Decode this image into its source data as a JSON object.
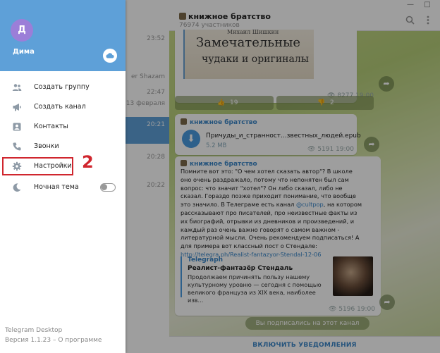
{
  "window": {
    "controls": [
      "—",
      "□"
    ]
  },
  "chatlist": {
    "rows": [
      {
        "time": "23:52",
        "snippet": "",
        "active": false
      },
      {
        "time": "",
        "snippet": "er Shazam",
        "active": false
      },
      {
        "time": "22:47",
        "snippet": "13 февраля",
        "active": false
      },
      {
        "time": "20:21",
        "snippet": "",
        "active": true
      },
      {
        "time": "20:28",
        "snippet": "",
        "active": false
      },
      {
        "time": "20:22",
        "snippet": "",
        "active": false
      }
    ]
  },
  "chat": {
    "title": "книжное братство",
    "subtitle": "76974 участников",
    "book_top_text": "Михаил Шишкин",
    "book_line1": "Замечательные",
    "book_line2": "чудаки и оригиналы",
    "msg1_meta": "8277  19:00",
    "reaction_like_count": "19",
    "reaction_dislike_count": "2",
    "file_source": "книжное братство",
    "file_name": "Причуды_и_странност...звестных_людей.epub",
    "file_size": "5.2 MB",
    "file_meta": "5191  19:00",
    "text_source": "книжное братство",
    "text_body_1": "Помните вот это: \"О чем хотел сказать автор\"? В школе оно очень раздражало, потому что непонятен был сам вопрос: что значит \"хотел\"? Он либо сказал, либо не сказал. Гораздо позже приходит понимание, что вообще это значило. В Телеграме есть канал ",
    "text_link_1": "@cultpop",
    "text_body_2": ", на котором рассказывают про писателей, про неизвестные факты из их биографий, отрывки из дневников и произведений, и каждый раз очень важно говорят о самом важном - литературной мысли. Очень рекомендуем подписаться! А для примера вот классный пост о Стендале:",
    "text_link_2": "http://telegra.ph/Realist-fantazyor-Stendal-12-06",
    "preview_site": "Telegraph",
    "preview_title": "Реалист-фантазёр Стендаль",
    "preview_desc": "Продолжаем причинять пользу нашему культурному уровню — сегодня с помощью великого француза из XIX века, наиболее изв...",
    "text_meta": "5196  19:00",
    "subscribed_text": "Вы подписались на этот канал",
    "notify_label": "ВКЛЮЧИТЬ УВЕДОМЛЕНИЯ"
  },
  "menu": {
    "avatar_letter": "Д",
    "user_name": "Дима",
    "items": [
      {
        "label": "Создать группу",
        "icon": "group-icon"
      },
      {
        "label": "Создать канал",
        "icon": "megaphone-icon"
      },
      {
        "label": "Контакты",
        "icon": "contact-icon"
      },
      {
        "label": "Звонки",
        "icon": "phone-icon"
      },
      {
        "label": "Настройки",
        "icon": "gear-icon"
      },
      {
        "label": "Ночная тема",
        "icon": "moon-icon"
      }
    ],
    "night_mode_on": false,
    "app_name": "Telegram Desktop",
    "app_version": "Версия 1.1.23 – О программе"
  },
  "annotation": {
    "step_number": "2",
    "color": "#d0262e"
  },
  "colors": {
    "accent": "#5ea0d8",
    "link": "#3a86c8"
  }
}
